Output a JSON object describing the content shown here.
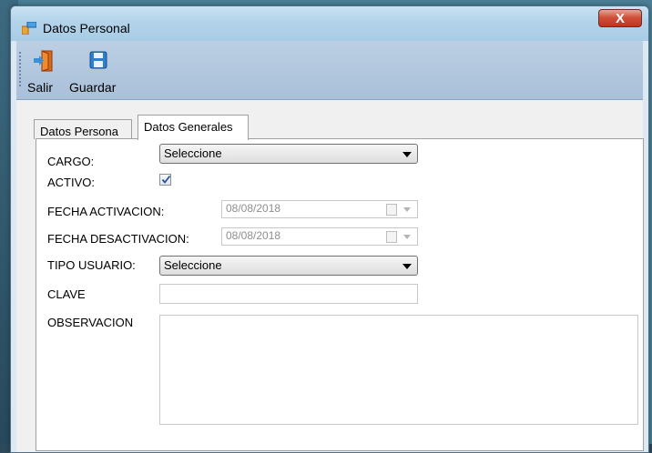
{
  "window": {
    "title": "Datos Personal",
    "close_symbol": "X"
  },
  "toolbar": {
    "items": [
      {
        "label": "Salir",
        "icon": "exit-door-icon"
      },
      {
        "label": "Guardar",
        "icon": "floppy-save-icon"
      }
    ]
  },
  "tabs": [
    {
      "label": "Datos Persona",
      "active": false
    },
    {
      "label": "Datos Generales",
      "active": true
    }
  ],
  "form": {
    "cargo": {
      "label": "CARGO:",
      "value": "Seleccione"
    },
    "activo": {
      "label": "ACTIVO:",
      "checked": true
    },
    "fecha_activacion": {
      "label": "FECHA ACTIVACION:",
      "value": "08/08/2018"
    },
    "fecha_desactivacion": {
      "label": "FECHA DESACTIVACION:",
      "value": "08/08/2018"
    },
    "tipo_usuario": {
      "label": "TIPO USUARIO:",
      "value": "Seleccione"
    },
    "clave": {
      "label": "CLAVE",
      "value": ""
    },
    "observacion": {
      "label": "OBSERVACION",
      "value": ""
    }
  },
  "colors": {
    "toolbar_bg": "#a9c0d9",
    "close_button": "#c2341d",
    "title_bar": "#b3d3ea"
  }
}
